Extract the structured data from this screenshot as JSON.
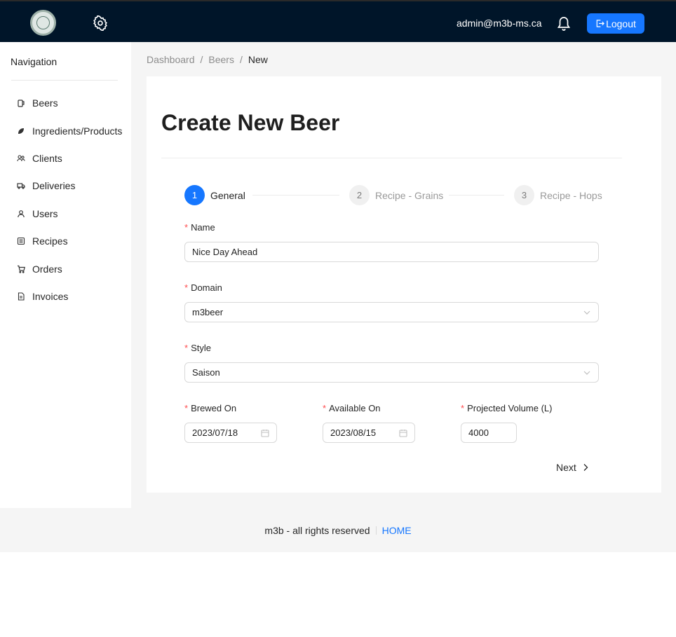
{
  "header": {
    "user_email": "admin@m3b-ms.ca",
    "logout_label": "Logout",
    "bg_color": "#001529",
    "accent_color": "#1677ff"
  },
  "sidebar": {
    "title": "Navigation",
    "items": [
      {
        "label": "Beers",
        "icon": "beer-icon"
      },
      {
        "label": "Ingredients/Products",
        "icon": "leaf-icon"
      },
      {
        "label": "Clients",
        "icon": "team-icon"
      },
      {
        "label": "Deliveries",
        "icon": "truck-icon"
      },
      {
        "label": "Users",
        "icon": "user-icon"
      },
      {
        "label": "Recipes",
        "icon": "recipe-icon"
      },
      {
        "label": "Orders",
        "icon": "cart-icon"
      },
      {
        "label": "Invoices",
        "icon": "file-icon"
      }
    ]
  },
  "breadcrumb": {
    "items": [
      "Dashboard",
      "Beers",
      "New"
    ]
  },
  "page": {
    "title": "Create New Beer"
  },
  "steps": [
    {
      "num": "1",
      "label": "General",
      "active": true
    },
    {
      "num": "2",
      "label": "Recipe - Grains",
      "active": false
    },
    {
      "num": "3",
      "label": "Recipe - Hops",
      "active": false
    }
  ],
  "form": {
    "name": {
      "label": "Name",
      "value": "Nice Day Ahead"
    },
    "domain": {
      "label": "Domain",
      "value": "m3beer"
    },
    "style": {
      "label": "Style",
      "value": "Saison"
    },
    "brewed_on": {
      "label": "Brewed On",
      "value": "2023/07/18"
    },
    "available_on": {
      "label": "Available On",
      "value": "2023/08/15"
    },
    "projected_volume": {
      "label": "Projected Volume (L)",
      "value": "4000"
    },
    "next_label": "Next"
  },
  "footer": {
    "text": "m3b - all rights reserved",
    "home_label": "HOME"
  }
}
